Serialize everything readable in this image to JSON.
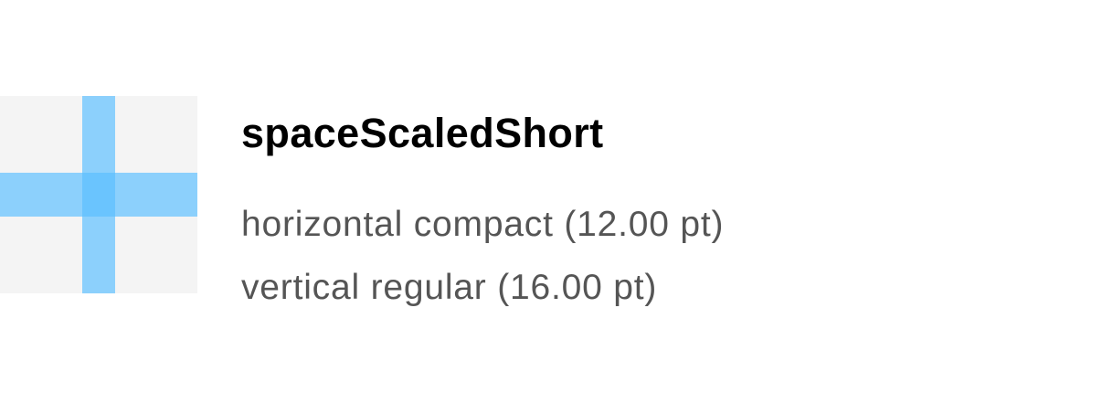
{
  "token": {
    "name": "spaceScaledShort",
    "horizontal": "horizontal compact (12.00 pt)",
    "vertical": "vertical regular (16.00 pt)"
  },
  "swatch": {
    "background_color": "#f4f4f4",
    "bar_color": "#5abeff"
  }
}
